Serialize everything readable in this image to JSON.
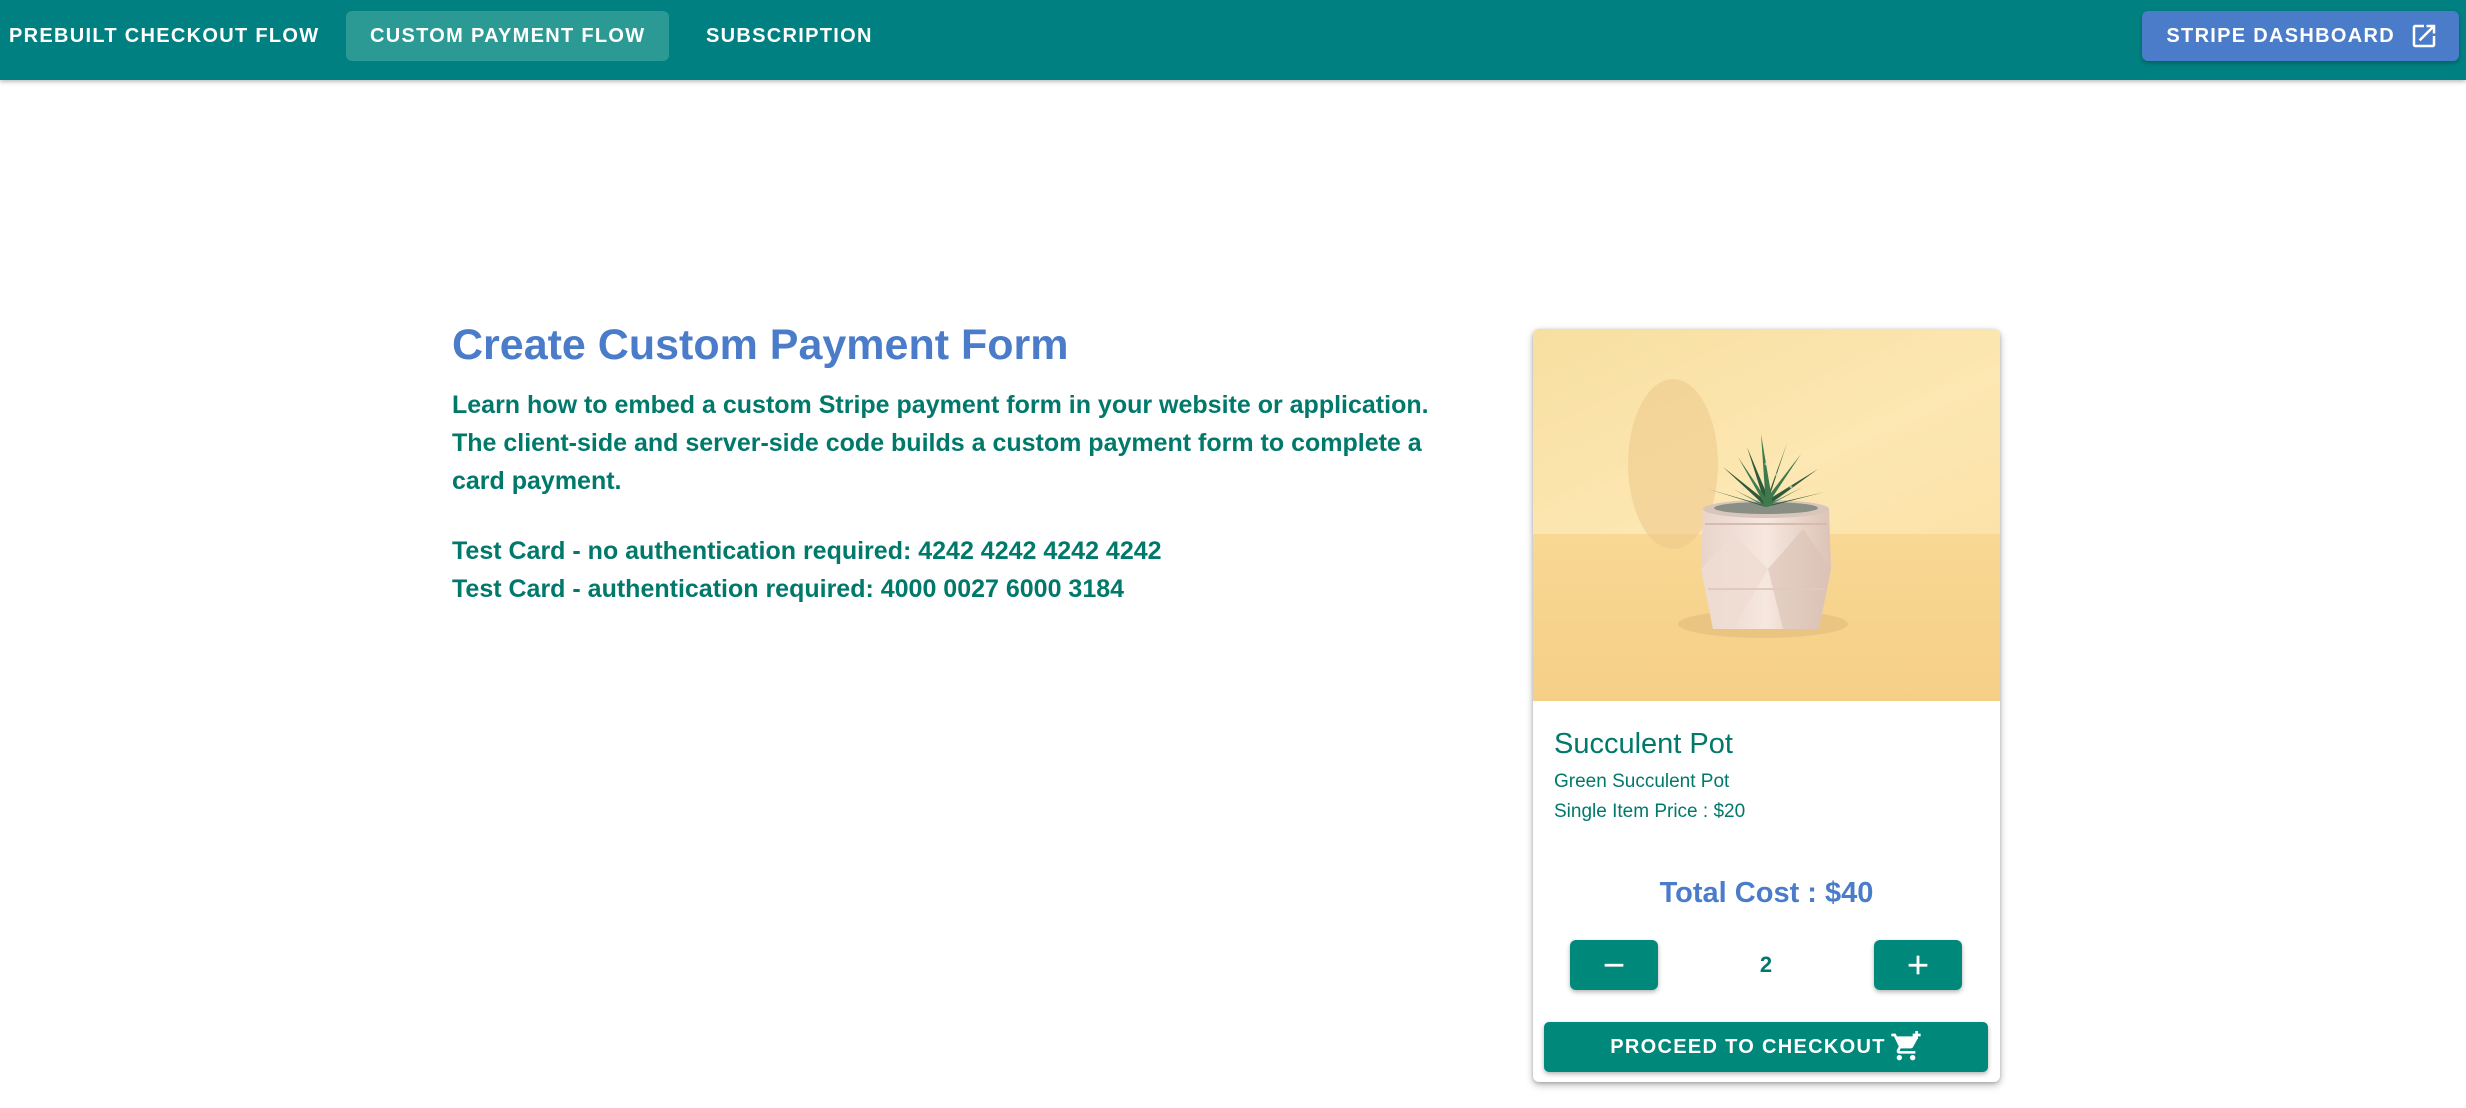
{
  "nav": {
    "tabs": [
      {
        "label": "Prebuilt Checkout Flow",
        "active": false
      },
      {
        "label": "Custom Payment Flow",
        "active": true
      },
      {
        "label": "Subscription",
        "active": false
      }
    ],
    "dashboard_label": "Stripe Dashboard",
    "dashboard_icon": "open-in-new-icon"
  },
  "intro": {
    "title": "Create Custom Payment Form",
    "line1": "Learn how to embed a custom Stripe payment form in your website or application.",
    "line2": "The client-side and server-side code builds a custom payment form to complete a card payment.",
    "test_card_1": "Test Card - no authentication required: 4242 4242 4242 4242",
    "test_card_2": "Test Card - authentication required: 4000 0027 6000 3184"
  },
  "product": {
    "image_icon": "succulent-pot-image",
    "name": "Succulent Pot",
    "description": "Green Succulent Pot",
    "price_text": "Single Item Price : $20",
    "total_text": "Total Cost : $40",
    "quantity": "2",
    "minus_icon": "minus-icon",
    "plus_icon": "plus-icon",
    "checkout_label": "Proceed to Checkout",
    "checkout_icon": "cart-icon"
  },
  "colors": {
    "appbar": "#008080",
    "active_tab": "#2b9a95",
    "accent_blue": "#4a7cc9",
    "teal_text": "#00796b",
    "button_teal": "#00897b"
  }
}
